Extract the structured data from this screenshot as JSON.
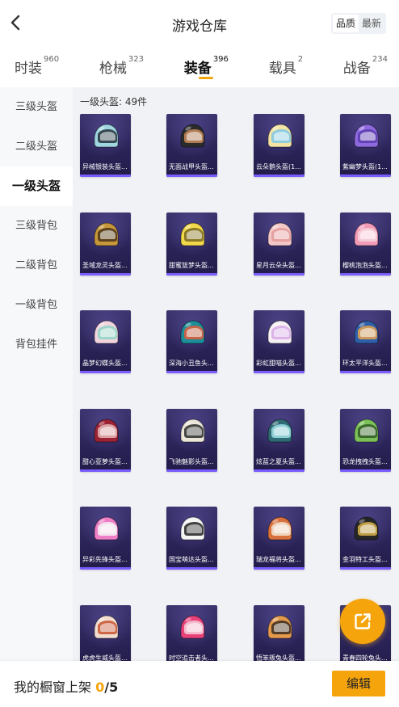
{
  "header": {
    "title": "游戏仓库",
    "sort_options": [
      "品质",
      "最新"
    ],
    "sort_active": "品质"
  },
  "tabs": [
    {
      "label": "时装",
      "count": "960"
    },
    {
      "label": "枪械",
      "count": "323"
    },
    {
      "label": "装备",
      "count": "396",
      "active": true
    },
    {
      "label": "载具",
      "count": "2"
    },
    {
      "label": "战备",
      "count": "234"
    }
  ],
  "sidebar": {
    "items": [
      {
        "label": "三级头盔"
      },
      {
        "label": "二级头盔"
      },
      {
        "label": "一级头盔",
        "active": true
      },
      {
        "label": "三级背包"
      },
      {
        "label": "二级背包"
      },
      {
        "label": "一级背包"
      },
      {
        "label": "背包挂件"
      }
    ]
  },
  "content": {
    "section_label": "一级头盔: 49件",
    "items": [
      {
        "name": "异械银装头盔...",
        "colors": [
          "#9fd6e0",
          "#23303a"
        ],
        "icon": "helmet-icon"
      },
      {
        "name": "无面战甲头盔...",
        "colors": [
          "#2b2b2b",
          "#c98a5a"
        ],
        "icon": "helmet-icon"
      },
      {
        "name": "云朵鹅头盔(1...",
        "colors": [
          "#f3e3a4",
          "#7cc8e8"
        ],
        "icon": "helmet-icon"
      },
      {
        "name": "紫幽梦头盔(1...",
        "colors": [
          "#8f6adf",
          "#5b3bb0"
        ],
        "icon": "helmet-icon"
      },
      {
        "name": "圣域龙灵头盔...",
        "colors": [
          "#c8973a",
          "#4a3418"
        ],
        "icon": "helmet-icon"
      },
      {
        "name": "甜蜜篮梦头盔...",
        "colors": [
          "#f1d84a",
          "#7a6a20"
        ],
        "icon": "helmet-icon"
      },
      {
        "name": "星月云朵头盔...",
        "colors": [
          "#f4c8c8",
          "#e39a9a"
        ],
        "icon": "helmet-icon"
      },
      {
        "name": "樱桃泡泡头盔...",
        "colors": [
          "#f29ab6",
          "#f7d3de"
        ],
        "icon": "helmet-icon"
      },
      {
        "name": "晶梦幻蝶头盔...",
        "colors": [
          "#f2d4de",
          "#8ed5c4"
        ],
        "icon": "helmet-icon"
      },
      {
        "name": "深海小丑鱼头...",
        "colors": [
          "#1d8f9a",
          "#e45c3a"
        ],
        "icon": "helmet-icon"
      },
      {
        "name": "彩虹甜喵头盔...",
        "colors": [
          "#f6f0f4",
          "#d7a8e6"
        ],
        "icon": "helmet-icon"
      },
      {
        "name": "环太平洋头盔...",
        "colors": [
          "#2e5fa8",
          "#e8a34c"
        ],
        "icon": "helmet-icon"
      },
      {
        "name": "甜心亚萝头盔...",
        "colors": [
          "#9b2335",
          "#e8b7b7"
        ],
        "icon": "helmet-icon"
      },
      {
        "name": "飞驰魅影头盔...",
        "colors": [
          "#ece6d8",
          "#2b2b2b"
        ],
        "icon": "helmet-icon"
      },
      {
        "name": "炫蓝之夏头盔...",
        "colors": [
          "#2f6b74",
          "#9ee0e6"
        ],
        "icon": "helmet-icon"
      },
      {
        "name": "恐龙拽拽头盔...",
        "colors": [
          "#7cc05a",
          "#2f5a23"
        ],
        "icon": "helmet-icon"
      },
      {
        "name": "异彩先锋头盔...",
        "colors": [
          "#ee7fc6",
          "#f4f4f4"
        ],
        "icon": "helmet-icon"
      },
      {
        "name": "国宝萌达头盔...",
        "colors": [
          "#f4f4f4",
          "#222222"
        ],
        "icon": "helmet-icon"
      },
      {
        "name": "瑞龙福将头盔...",
        "colors": [
          "#d9713c",
          "#f2e4d2"
        ],
        "icon": "helmet-icon"
      },
      {
        "name": "金羽特工头盔...",
        "colors": [
          "#262626",
          "#d9b14a"
        ],
        "icon": "helmet-icon"
      },
      {
        "name": "虎虎生威头盔...",
        "colors": [
          "#f2ddd0",
          "#c8522e"
        ],
        "icon": "helmet-icon"
      },
      {
        "name": "时空追击者头...",
        "colors": [
          "#e8417a",
          "#f6d0dc"
        ],
        "icon": "helmet-icon"
      },
      {
        "name": "悟笨叛兔头盔...",
        "colors": [
          "#e39a4d",
          "#3a2a1e"
        ],
        "icon": "helmet-icon"
      },
      {
        "name": "青春四轮兔头...",
        "colors": [
          "#8bc3d9",
          "#f3e7c0"
        ],
        "icon": "helmet-icon"
      }
    ]
  },
  "fab": {
    "icon": "share-external-icon",
    "color": "#f5a40c"
  },
  "footer": {
    "label": "我的橱窗上架",
    "count": "0",
    "total": "/5",
    "edit_label": "编辑"
  }
}
